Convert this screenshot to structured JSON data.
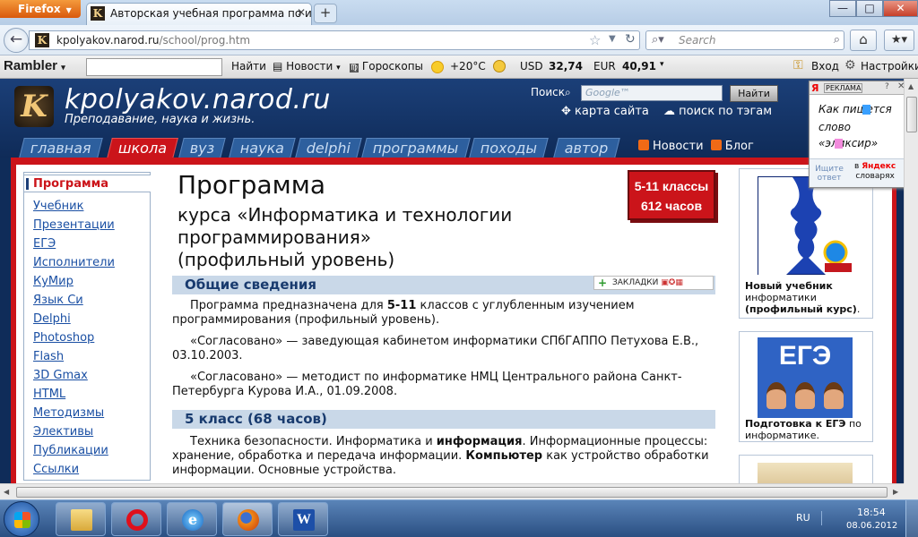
{
  "browser": {
    "app_button": "Firefox",
    "tab_title": "Авторская учебная программа по инф...",
    "new_tab": "+",
    "window": {
      "minimize": "—",
      "maximize": "□",
      "close": "✕"
    },
    "url_host": "kpolyakov.narod.ru",
    "url_path": "/school/prog.htm",
    "search_placeholder": "Search"
  },
  "rambler_toolbar": {
    "logo": "Rambler",
    "find": "Найти",
    "news": "Новости",
    "horoscopes": "Гороскопы",
    "temperature": "+20°C",
    "usd_label": "USD",
    "usd_value": "32,74",
    "eur_label": "EUR",
    "eur_value": "40,91",
    "login": "Вход",
    "settings": "Настройки"
  },
  "site": {
    "title": "kpolyakov.narod.ru",
    "subtitle": "Преподавание, наука и жизнь.",
    "search_label": "Поиск",
    "search_placeholder": "Google™",
    "search_button": "Найти",
    "sitemap": "карта сайта",
    "tag_search": "поиск по тэгам",
    "nav_tabs": [
      "главная",
      "школа",
      "вуз",
      "наука",
      "delphi",
      "программы",
      "походы",
      "автор"
    ],
    "active_tab": "школа",
    "news_link": "Новости",
    "blog_link": "Блог"
  },
  "left_nav": {
    "active": "Программа",
    "items": [
      "Учебник",
      "Презентации",
      "ЕГЭ",
      "Исполнители",
      "КуМир",
      "Язык Си",
      "Delphi",
      "Photoshop",
      "Flash",
      "3D Gmax",
      "HTML",
      "Методизмы",
      "Элективы",
      "Публикации",
      "Ссылки"
    ]
  },
  "main": {
    "h1": "Программа",
    "h2_line1": "курса «Информатика и технологии",
    "h2_line2": "программирования»",
    "h2_line3": "(профильный уровень)",
    "badge_line1": "5-11 классы",
    "badge_line2": "612 часов",
    "section1": "Общие сведения",
    "bookmarks": "ЗАКЛАДКИ",
    "p1_a": "Программа предназначена для ",
    "p1_b": "5-11",
    "p1_c": " классов с углубленным изучением программирования (профильный уровень).",
    "p2": "«Согласовано» — заведующая кабинетом информатики СПбГАППО Петухова Е.В., 03.10.2003.",
    "p3": "«Согласовано» — методист по информатике НМЦ Центрального района Санкт-Петербурга Курова И.А., 01.09.2008.",
    "section2": "5 класс (68 часов)",
    "p4_a": "Техника безопасности. Информатика и ",
    "p4_b": "информация",
    "p4_c": ". Информационные процессы: хранение, обработка и передача информации. ",
    "p4_d": "Компьютер",
    "p4_e": " как устройство обработки информации. Основные устройства."
  },
  "right_col": {
    "card1_bold1": "Новый учебник",
    "card1_text": "информатики",
    "card1_bold2": "(профильный курс)",
    "card1_end": ".",
    "card2_title": "ЕГЭ",
    "card2_bold": "Подготовка к ЕГЭ",
    "card2_text": " по информатике."
  },
  "ad": {
    "label": "РЕКЛАМА",
    "word1": "Как пишется",
    "word2": "слово",
    "word3": "«эликсир»",
    "foot_left": "Ищите ответ",
    "foot_right_a": "в",
    "foot_right_b": "Яндекс",
    "foot_right_c": "словарях"
  },
  "taskbar": {
    "lang": "RU",
    "time": "18:54",
    "date": "08.06.2012"
  }
}
